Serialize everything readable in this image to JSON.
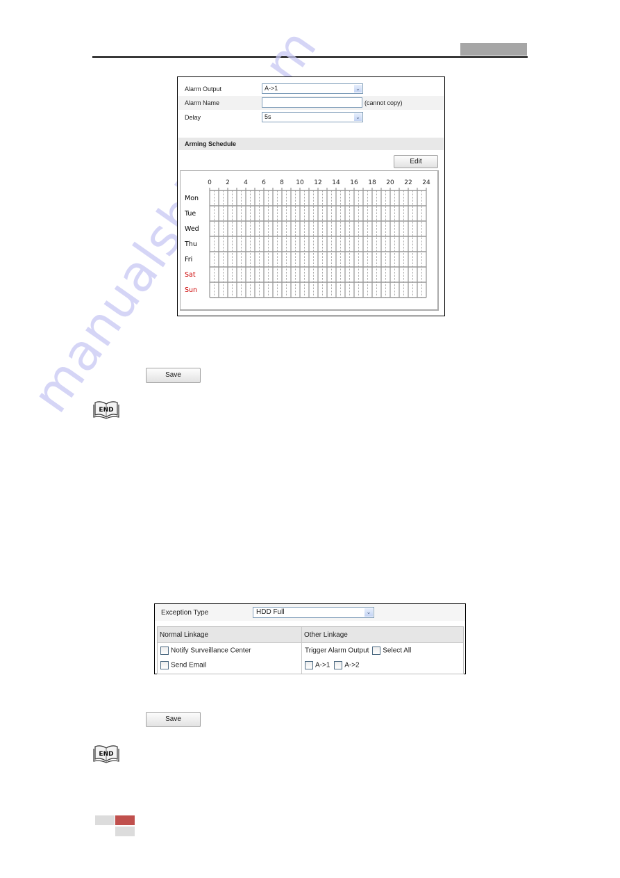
{
  "watermark": "manualshive.com",
  "alarm_output_panel": {
    "rows": [
      {
        "label": "Alarm Output",
        "type": "select",
        "value": "A->1"
      },
      {
        "label": "Alarm Name",
        "type": "text",
        "value": "",
        "note": "(cannot copy)"
      },
      {
        "label": "Delay",
        "type": "select",
        "value": "5s"
      }
    ],
    "arming_schedule_title": "Arming Schedule",
    "edit_label": "Edit",
    "schedule": {
      "hour_labels": [
        "0",
        "2",
        "4",
        "6",
        "8",
        "10",
        "12",
        "14",
        "16",
        "18",
        "20",
        "22",
        "24"
      ],
      "days": [
        {
          "label": "Mon",
          "color": "#000000"
        },
        {
          "label": "Tue",
          "color": "#000000"
        },
        {
          "label": "Wed",
          "color": "#000000"
        },
        {
          "label": "Thu",
          "color": "#000000"
        },
        {
          "label": "Fri",
          "color": "#000000"
        },
        {
          "label": "Sat",
          "color": "#cc0000"
        },
        {
          "label": "Sun",
          "color": "#cc0000"
        }
      ]
    }
  },
  "save1_label": "Save",
  "end_icon_label": "END",
  "exception_panel": {
    "exception_type_label": "Exception Type",
    "exception_type_value": "HDD Full",
    "normal_linkage_header": "Normal Linkage",
    "other_linkage_header": "Other Linkage",
    "normal_items": [
      "Notify Surveillance Center",
      "Send Email"
    ],
    "trigger_label": "Trigger Alarm Output",
    "select_all_label": "Select All",
    "outputs": [
      "A->1",
      "A->2"
    ]
  },
  "save2_label": "Save",
  "colors": {
    "footer_accent": "#c0504d",
    "weekend": "#cc0000"
  }
}
